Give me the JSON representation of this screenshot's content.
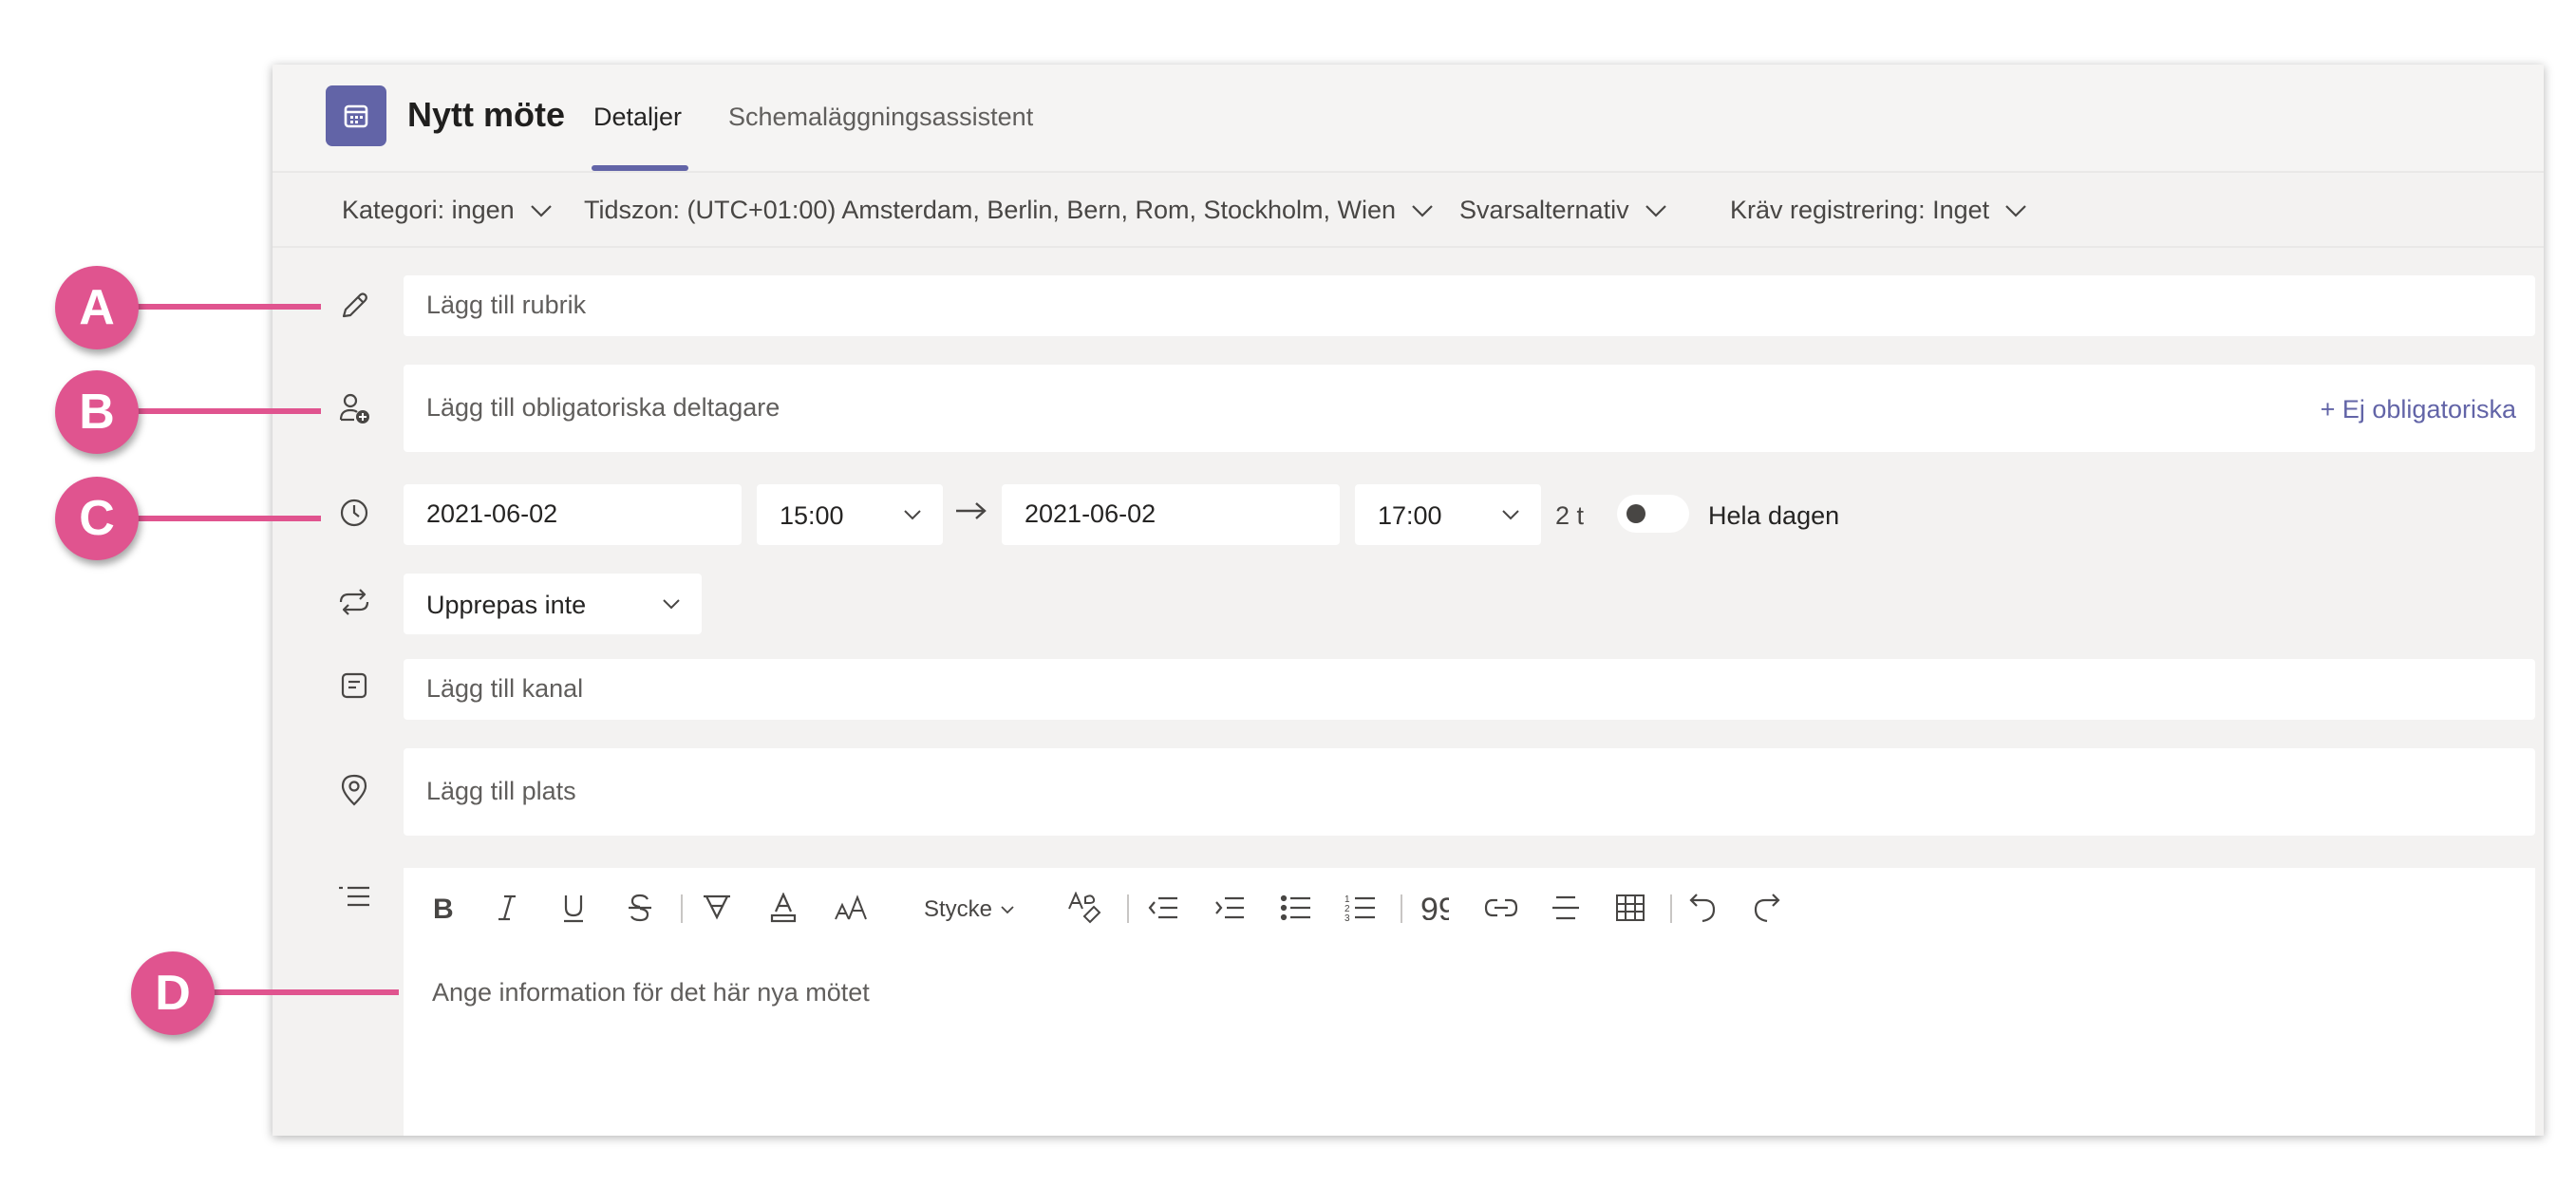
{
  "header": {
    "title": "Nytt möte",
    "tabs": [
      {
        "label": "Detaljer",
        "active": true
      },
      {
        "label": "Schemaläggningsassistent",
        "active": false
      }
    ]
  },
  "options": [
    {
      "label": "Kategori: ingen"
    },
    {
      "label": "Tidszon: (UTC+01:00) Amsterdam, Berlin, Bern, Rom, Stockholm, Wien"
    },
    {
      "label": "Svarsalternativ"
    },
    {
      "label": "Kräv registrering: Inget"
    }
  ],
  "form": {
    "title_placeholder": "Lägg till rubrik",
    "attendees_placeholder": "Lägg till obligatoriska deltagare",
    "optional_link": "+ Ej obligatoriska",
    "start_date": "2021-06-02",
    "start_time": "15:00",
    "end_date": "2021-06-02",
    "end_time": "17:00",
    "duration": "2 t",
    "all_day_label": "Hela dagen",
    "all_day_on": false,
    "repeat": "Upprepas inte",
    "channel_placeholder": "Lägg till kanal",
    "location_placeholder": "Lägg till plats"
  },
  "editor": {
    "paragraph_style": "Stycke",
    "placeholder": "Ange information för det här nya mötet",
    "toolbar_icons": [
      "bold-icon",
      "italic-icon",
      "underline-icon",
      "strikethrough-icon",
      "highlight-icon",
      "font-color-icon",
      "font-size-icon",
      "paragraph-style",
      "format-painter-icon",
      "decrease-indent-icon",
      "increase-indent-icon",
      "bulleted-list-icon",
      "numbered-list-icon",
      "quote-icon",
      "link-icon",
      "horizontal-rule-icon",
      "table-icon",
      "undo-icon",
      "redo-icon"
    ]
  },
  "callouts": [
    "A",
    "B",
    "C",
    "D"
  ],
  "colors": {
    "accent": "#6264a7",
    "callout": "#e0548f",
    "background": "#f3f2f1"
  }
}
